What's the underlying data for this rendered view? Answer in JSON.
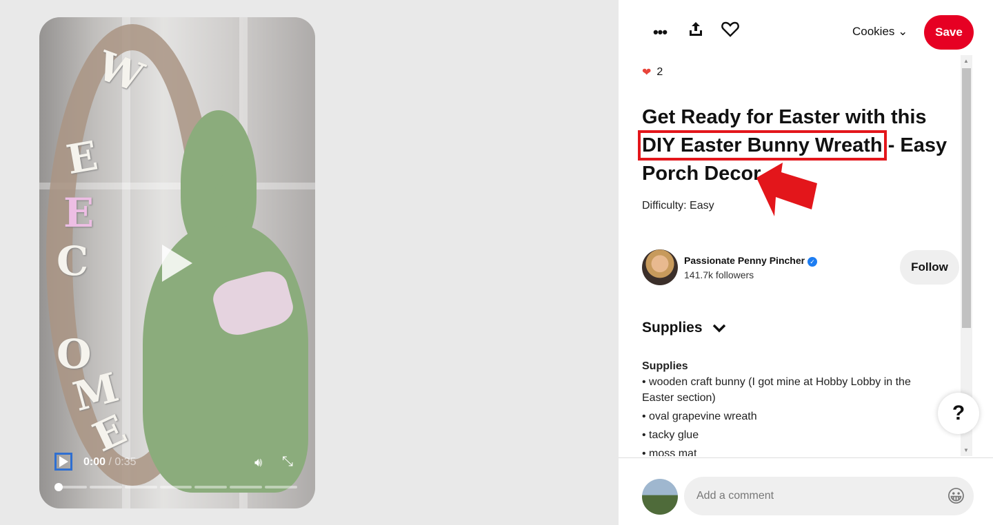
{
  "video": {
    "current_time": "0:00",
    "duration": "0:35",
    "time_separator": " / ",
    "letters": [
      "W",
      "E",
      "L",
      "C",
      "O",
      "M",
      "E"
    ],
    "progress_fraction": 0
  },
  "toolbar": {
    "more_icon": "ellipsis-icon",
    "share_icon": "upload-icon",
    "like_icon": "heart-outline-icon",
    "board": "Cookies",
    "save_label": "Save"
  },
  "pin": {
    "reaction_count": "2",
    "title_before": "Get Ready for Easter with this ",
    "title_highlight": "DIY Easter Bunny Wreath",
    "title_after": " - Easy Porch Decor",
    "difficulty": "Difficulty: Easy"
  },
  "author": {
    "name": "Passionate Penny Pincher",
    "followers": "141.7k followers",
    "follow_label": "Follow"
  },
  "supplies": {
    "section_title": "Supplies",
    "heading": "Supplies",
    "items": [
      "• wooden craft bunny (I got mine at Hobby Lobby in the Easter section)",
      "• oval grapevine wreath",
      "• tacky glue",
      "• moss mat"
    ]
  },
  "comment": {
    "placeholder": "Add a comment"
  },
  "help_label": "?",
  "colors": {
    "save": "#e60023",
    "annotation": "#e3161b",
    "verified": "#1d7df2"
  }
}
